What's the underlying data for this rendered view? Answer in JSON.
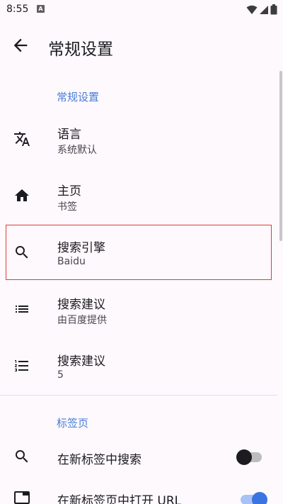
{
  "status_bar": {
    "time": "8:55",
    "notification_letter": "A"
  },
  "app_bar": {
    "title": "常规设置"
  },
  "sections": [
    {
      "header": "常规设置"
    },
    {
      "header": "标签页"
    }
  ],
  "prefs": [
    {
      "title": "语言",
      "summary": "系统默认",
      "icon": "translate-icon"
    },
    {
      "title": "主页",
      "summary": "书签",
      "icon": "home-icon"
    },
    {
      "title": "搜索引擎",
      "summary": "Baidu",
      "icon": "search-icon"
    },
    {
      "title": "搜索建议",
      "summary": "由百度提供",
      "icon": "list-icon"
    },
    {
      "title": "搜索建议",
      "summary": "5",
      "icon": "numbered-list-icon"
    }
  ],
  "switch_prefs": [
    {
      "title": "在新标签中搜索",
      "icon": "search-icon",
      "checked": false
    },
    {
      "title": "在新标签页中打开 URL",
      "icon": "tab-icon",
      "checked": true
    }
  ],
  "colors": {
    "accent": "#4a7dd6",
    "highlight_border": "#e23b3b",
    "background": "#fdf9fd"
  }
}
